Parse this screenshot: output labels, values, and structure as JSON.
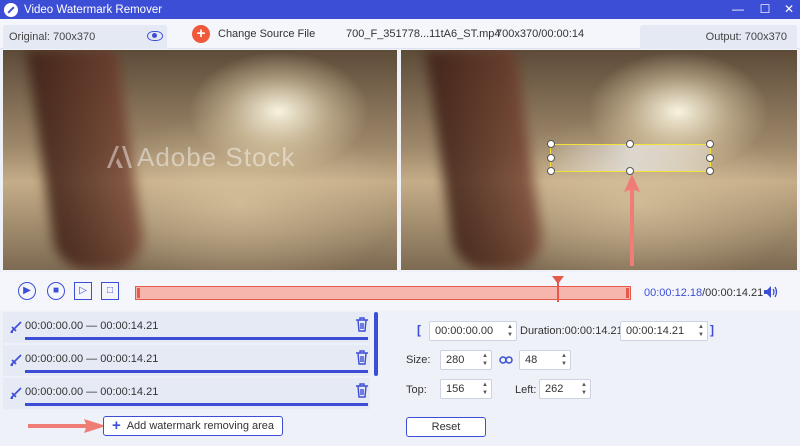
{
  "window": {
    "title": "Video Watermark Remover",
    "minimize": "—",
    "maximize": "☐",
    "close": "✕"
  },
  "infobar": {
    "original_label": "Original: 700x370",
    "change_source_label": "Change Source File",
    "file_name": "700_F_351778...11tA6_ST.mp4",
    "file_info": "700x370/00:00:14",
    "output_label": "Output: 700x370"
  },
  "video": {
    "watermark_text": "Adobe Stock"
  },
  "timeline": {
    "current_time": "00:00:12.18",
    "total_time": "/00:00:14.21",
    "playhead_fraction": 0.85
  },
  "areas": {
    "items": [
      {
        "range": "00:00:00.00 — 00:00:14.21"
      },
      {
        "range": "00:00:00.00 — 00:00:14.21"
      },
      {
        "range": "00:00:00.00 — 00:00:14.21"
      }
    ],
    "add_label": "Add watermark removing area"
  },
  "settings": {
    "start": "00:00:00.00",
    "duration_label": "Duration:00:00:14.21",
    "end": "00:00:14.21",
    "size_label": "Size:",
    "width": "280",
    "height": "48",
    "top_label": "Top:",
    "top": "156",
    "left_label": "Left:",
    "left": "262",
    "reset_label": "Reset"
  },
  "colors": {
    "accent": "#3d4ed6",
    "timeline": "#e55a4a",
    "highlight_box": "#f0e23a",
    "arrow": "#f07c76"
  }
}
